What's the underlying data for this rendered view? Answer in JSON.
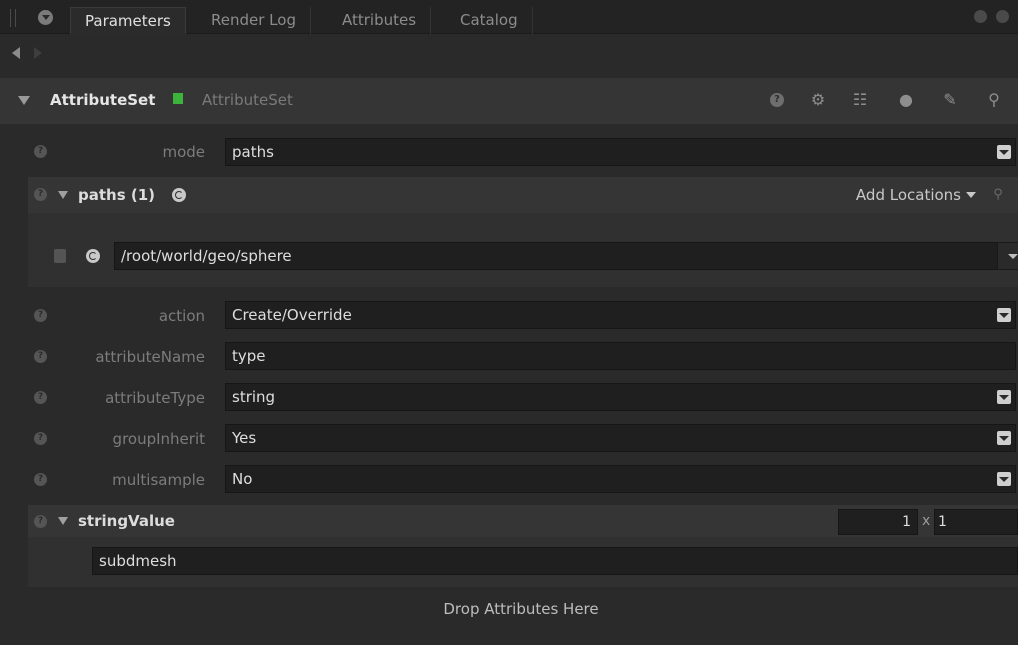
{
  "tabs": [
    {
      "label": "Parameters",
      "active": true
    },
    {
      "label": "Render Log",
      "active": false
    },
    {
      "label": "Attributes",
      "active": false
    },
    {
      "label": "Catalog",
      "active": false
    }
  ],
  "node": {
    "name": "AttributeSet",
    "type": "AttributeSet",
    "status_color": "#3cb43c"
  },
  "header_icons": [
    "help-icon",
    "gear-icon",
    "node-graph-icon",
    "comment-icon",
    "wrench-icon",
    "search-icon"
  ],
  "params": {
    "mode": {
      "label": "mode",
      "value": "paths"
    },
    "paths": {
      "title": "paths (1)",
      "add_locations": "Add Locations",
      "items": [
        "/root/world/geo/sphere"
      ]
    },
    "action": {
      "label": "action",
      "value": "Create/Override"
    },
    "attributeName": {
      "label": "attributeName",
      "value": "type"
    },
    "attributeType": {
      "label": "attributeType",
      "value": "string"
    },
    "groupInherit": {
      "label": "groupInherit",
      "value": "Yes"
    },
    "multisample": {
      "label": "multisample",
      "value": "No"
    },
    "stringValue": {
      "title": "stringValue",
      "rows": "1",
      "x": "x",
      "cols": "1",
      "value": "subdmesh"
    }
  },
  "drop_hint": "Drop Attributes Here"
}
